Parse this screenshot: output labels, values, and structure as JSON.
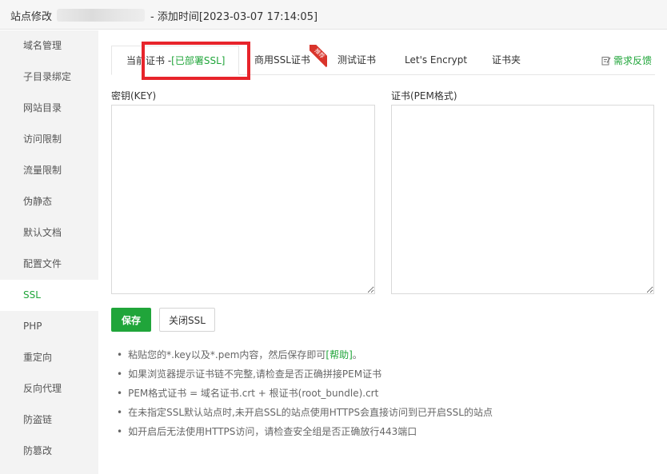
{
  "title": {
    "prefix": "站点修改",
    "suffix": "- 添加时间[2023-03-07 17:14:05]"
  },
  "sidebar": {
    "items": [
      {
        "label": "域名管理"
      },
      {
        "label": "子目录绑定"
      },
      {
        "label": "网站目录"
      },
      {
        "label": "访问限制"
      },
      {
        "label": "流量限制"
      },
      {
        "label": "伪静态"
      },
      {
        "label": "默认文档"
      },
      {
        "label": "配置文件"
      },
      {
        "label": "SSL"
      },
      {
        "label": "PHP"
      },
      {
        "label": "重定向"
      },
      {
        "label": "反向代理"
      },
      {
        "label": "防盗链"
      },
      {
        "label": "防篡改"
      }
    ],
    "active": "SSL"
  },
  "tabs": {
    "current_label": "当前证书 -",
    "current_status": "[已部署SSL]",
    "commercial": "商用SSL证书",
    "ribbon": "推荐",
    "test": "测试证书",
    "letsencrypt": "Let's Encrypt",
    "folder": "证书夹",
    "feedback": "需求反馈"
  },
  "form": {
    "key_label": "密钥(KEY)",
    "cert_label": "证书(PEM格式)",
    "key_value": "",
    "cert_value": "",
    "save_label": "保存",
    "close_ssl_label": "关闭SSL"
  },
  "tips": {
    "t1_prefix": "粘贴您的*.key以及*.pem内容，然后保存即可",
    "t1_help": "[帮助]",
    "t1_suffix": "。",
    "t2": "如果浏览器提示证书链不完整,请检查是否正确拼接PEM证书",
    "t3": "PEM格式证书 = 域名证书.crt + 根证书(root_bundle).crt",
    "t4": "在未指定SSL默认站点时,未开启SSL的站点使用HTTPS会直接访问到已开启SSL的站点",
    "t5": "如开启后无法使用HTTPS访问，请检查安全组是否正确放行443端口"
  },
  "colors": {
    "accent": "#20a53a",
    "highlight": "#e7242b",
    "ribbon": "#d9342b"
  },
  "icons": {
    "feedback": "edit-icon"
  }
}
